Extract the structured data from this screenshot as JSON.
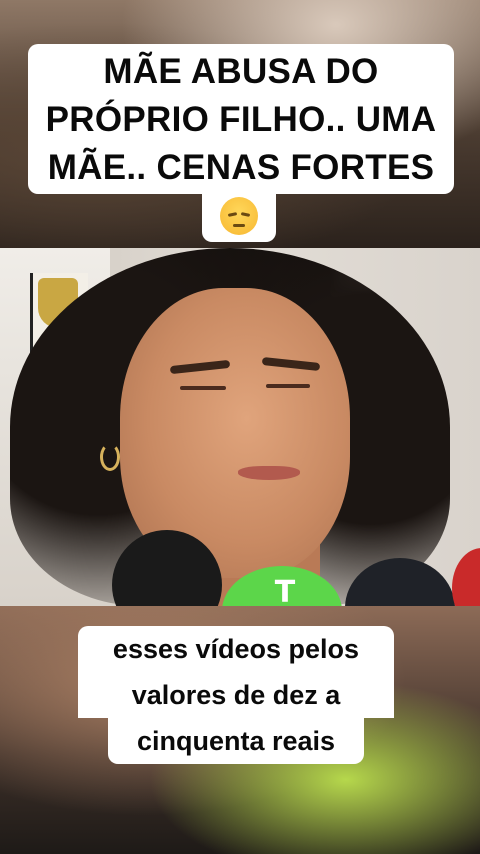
{
  "caption_top": {
    "lines": [
      "MÃE ABUSA DO",
      "PRÓPRIO FILHO.. UMA",
      "MÃE.. CENAS FORTES"
    ],
    "emoji": "pensive-face"
  },
  "caption_bottom": {
    "lines": [
      "esses vídeos pelos",
      "valores de dez a",
      "cinquenta reais"
    ]
  },
  "video": {
    "microphone_logo": "T"
  }
}
